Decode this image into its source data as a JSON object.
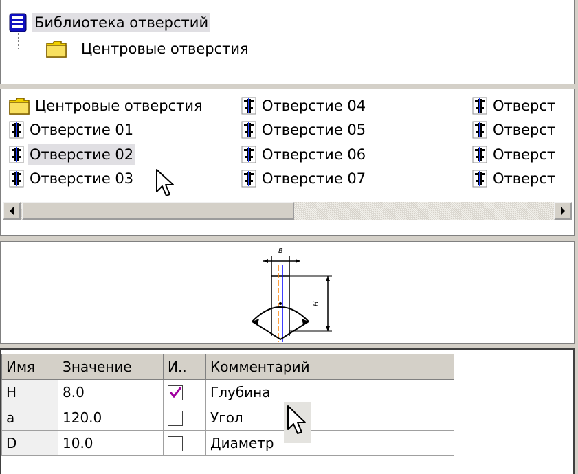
{
  "tree": {
    "root_label": "Библиотека отверстий",
    "child_label": "Центровые отверстия"
  },
  "list": {
    "items": [
      {
        "label": "Центровые отверстия",
        "icon": "folder-icon"
      },
      {
        "label": "Отверстие 01",
        "icon": "hole-icon"
      },
      {
        "label": "Отверстие 02",
        "icon": "hole-icon",
        "selected": true
      },
      {
        "label": "Отверстие 03",
        "icon": "hole-icon"
      },
      {
        "label": "Отверстие 04",
        "icon": "hole-icon"
      },
      {
        "label": "Отверстие 05",
        "icon": "hole-icon"
      },
      {
        "label": "Отверстие 06",
        "icon": "hole-icon"
      },
      {
        "label": "Отверстие 07",
        "icon": "hole-icon"
      },
      {
        "label": "Отверст",
        "icon": "hole-icon"
      },
      {
        "label": "Отверст",
        "icon": "hole-icon"
      },
      {
        "label": "Отверст",
        "icon": "hole-icon"
      },
      {
        "label": "Отверст",
        "icon": "hole-icon"
      }
    ]
  },
  "preview": {
    "label_b": "B",
    "label_h": "H"
  },
  "table": {
    "headers": [
      "Имя",
      "Значение",
      "И..",
      "Комментарий"
    ],
    "rows": [
      {
        "name": "H",
        "value": "8.0",
        "checked": true,
        "comment": "Глубина"
      },
      {
        "name": "a",
        "value": "120.0",
        "checked": false,
        "comment": "Угол"
      },
      {
        "name": "D",
        "value": "10.0",
        "checked": false,
        "comment": "Диаметр"
      }
    ]
  },
  "colors": {
    "selection": "#e0dfe3",
    "check": "#a000a0",
    "axis_orange": "#ff8000",
    "axis_blue": "#0000ff"
  }
}
